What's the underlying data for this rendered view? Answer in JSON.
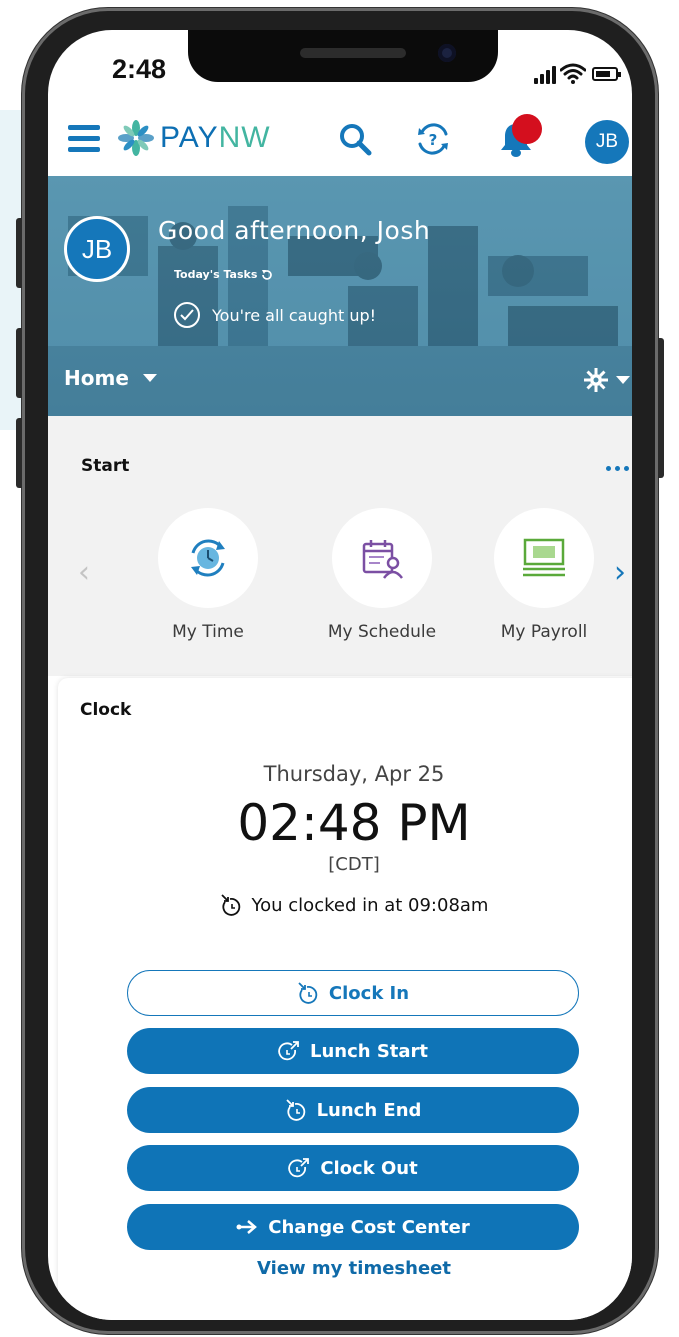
{
  "status_bar": {
    "time": "2:48"
  },
  "header": {
    "logo": {
      "part1": "PAY",
      "part2": "NW"
    },
    "avatar_initials": "JB",
    "icons": [
      "hamburger-icon",
      "search-icon",
      "help-icon",
      "bell-icon"
    ]
  },
  "hero": {
    "avatar_initials": "JB",
    "greeting": "Good afternoon, Josh",
    "tasks_label": "Today's Tasks",
    "caught_up": "You're all caught up!",
    "home_label": "Home"
  },
  "start": {
    "title": "Start",
    "tiles": [
      {
        "label": "My Time",
        "icon": "clock-icon"
      },
      {
        "label": "My Schedule",
        "icon": "calendar-person-icon"
      },
      {
        "label": "My Payroll",
        "icon": "cash-icon"
      }
    ]
  },
  "clock": {
    "title": "Clock",
    "date": "Thursday, Apr 25",
    "time": "02:48 PM",
    "timezone": "[CDT]",
    "status": "You clocked in at 09:08am",
    "buttons": {
      "clock_in": "Clock In",
      "lunch_start": "Lunch Start",
      "lunch_end": "Lunch End",
      "clock_out": "Clock Out",
      "change_cost_center": "Change Cost Center"
    },
    "timesheet_link": "View my timesheet"
  },
  "colors": {
    "primary": "#0f74b7",
    "logo_teal": "#43b5a1",
    "notification": "#d40f1e",
    "hero": "#4d8eaa"
  }
}
